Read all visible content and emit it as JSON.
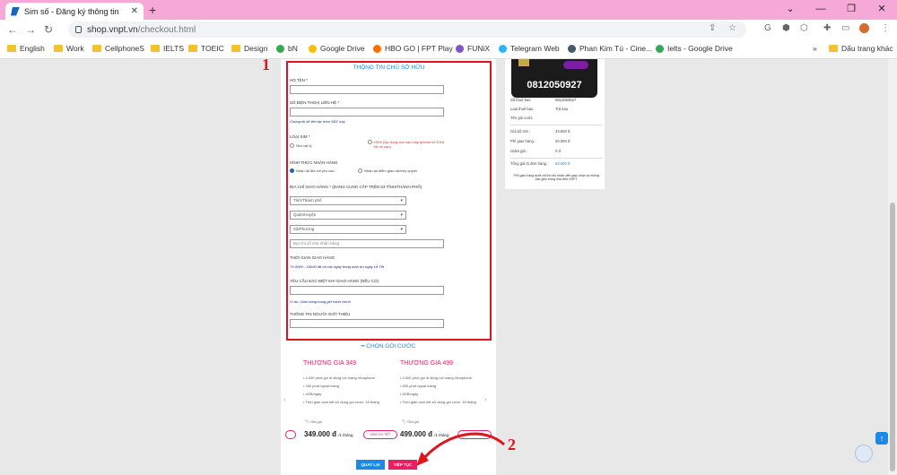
{
  "browser": {
    "tab_title": "Sim số - Đăng ký thông tin",
    "url_domain": "shop.vnpt.vn",
    "url_path": "/checkout.html",
    "bookmarks": [
      "English",
      "Work",
      "CellphoneS",
      "IELTS",
      "TOEIC",
      "Design",
      "bN",
      "Google Drive",
      "HBO GO | FPT Play",
      "FUNiX",
      "Telegram Web",
      "Phan Kim Tú - Cine...",
      "Ielts - Google Drive"
    ],
    "bookmarks_other": "Dấu trang khác"
  },
  "form": {
    "title": "THÔNG TIN CHỦ SỞ HỮU",
    "ho_ten_label": "HỌ TÊN *",
    "sdt_label": "SỐ ĐIỆN THOẠI LIÊN HỆ *",
    "sdt_note": "Chúng tôi sẽ liên lạc theo SĐT này",
    "loai_sim_label": "LOẠI SIM *",
    "sim_vat_ly": "Sim vật lý",
    "esim": "eSIM (Áp dụng cho các máy Iphone từ 2018 trở về sau)",
    "hinh_thuc_label": "HÌNH THỨC NHẬN HÀNG",
    "nhan_tai_dia_chi": "Nhận tại địa chỉ yêu cầu",
    "nhan_tai_diem": "Nhận tại điểm giao dịch/ủy quyền",
    "dia_chi_label": "ĐỊA CHỈ GIAO HÀNG * (ĐANG CUNG CẤP TRÊN 63 TỈNH/THÀNH PHỐ)",
    "tinh_placeholder": "Tỉnh/Thành phố",
    "quan_placeholder": "Quận/Huyện",
    "xa_placeholder": "Xã/Phường",
    "dia_chi_placeholder": "Địa chỉ số nhà nhận hàng",
    "thoi_gian_label": "THỜI GIAN GIAO HÀNG",
    "thoi_gian_note": "Từ 8h00 - 18h00 tất cả các ngày trong tuần trừ ngày Lễ Tết",
    "yeu_cau_label": "YÊU CẦU ĐẶC BIỆT KHI GIAO HÀNG (NẾU CÓ)",
    "yeu_cau_note": "Ví dụ: Giao hàng trong giờ hành chính",
    "gioi_thieu_label": "THÔNG TIN NGƯỜI GIỚI THIỆU"
  },
  "packages": {
    "header": "CHỌN GÓI CƯỚC",
    "items": [
      {
        "name": "THƯƠNG GIA 349",
        "features": [
          "4.000 phút gọi di động nội mạng Vinaphone",
          "400 phút ngoại mạng",
          "4GB/ngày",
          "Thời gian cam kết sử dụng gói cước: 18 tháng"
        ],
        "gia_label": "Giá gói",
        "price": "349.000 đ",
        "unit": "/1 tháng",
        "detail": "XEM CHI TIẾT"
      },
      {
        "name": "THƯƠNG GIA 499",
        "features": [
          "4.000 phút gọi di động nội mạng Vinaphone",
          "800 phút ngoại mạng",
          "6GB/ngày",
          "Thời gian cam kết sử dụng gói cước: 18 tháng"
        ],
        "gia_label": "Giá gói",
        "price": "499.000 đ",
        "unit": "/1 tháng",
        "detail": "XEM CHI TIẾT"
      }
    ]
  },
  "buttons": {
    "back": "QUAY LẠI",
    "next": "TIẾP TỤC"
  },
  "summary": {
    "sim_number": "0812050927",
    "rows": [
      {
        "k": "Số thuê bao",
        "v": "0812050927"
      },
      {
        "k": "Loại thuê bao",
        "v": "Trả sau"
      },
      {
        "k": "Tên gói cước",
        "v": ""
      },
      {
        "k": "Giá bộ sim :",
        "v": "43.500 đ"
      },
      {
        "k": "Phí giao hàng :",
        "v": "20.000 đ"
      },
      {
        "k": "Giảm giá :",
        "v": "0 đ"
      },
      {
        "k": "Tổng giá trị đơn hàng :",
        "v": "63.500 đ"
      }
    ],
    "note": "*Phí giao hàng dưới chỉ trả cho nhân viên giao nhận và không bao gồm trong hóa đơn VNPT"
  },
  "annotations": {
    "one": "1",
    "two": "2"
  }
}
